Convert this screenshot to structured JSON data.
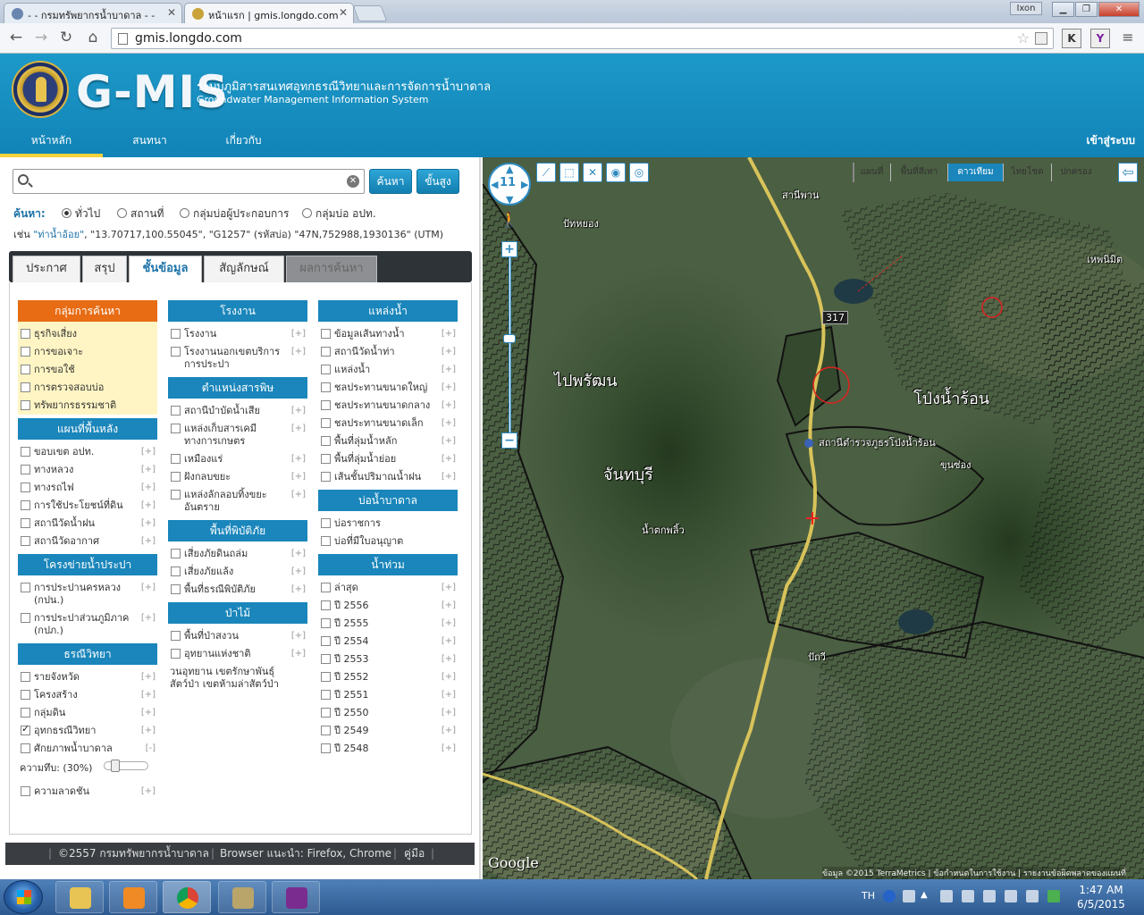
{
  "browser": {
    "tabs": [
      {
        "title": "- - กรมทรัพยากรน้ำบาดาล - -"
      },
      {
        "title": "หน้าแรก | gmis.longdo.com"
      }
    ],
    "user_badge": "Ixon",
    "address": "gmis.longdo.com",
    "toolbar_icons": [
      "K",
      "Y"
    ]
  },
  "header": {
    "brand": "G-MIS",
    "subtitle_th": "ระบบภูมิสารสนเทศอุทกธรณีวิทยาและการจัดการน้ำบาดาล",
    "subtitle_en": "Groundwater Management Information System",
    "menu": [
      {
        "label": "หน้าหลัก"
      },
      {
        "label": "สนทนา"
      },
      {
        "label": "เกี่ยวกับ"
      }
    ],
    "login": "เข้าสู่ระบบ"
  },
  "search": {
    "placeholder": "",
    "search_btn": "ค้นหา",
    "advanced_btn": "ขั้นสูง",
    "label": "ค้นหา:",
    "options": [
      {
        "label": "ทั่วไป",
        "selected": true
      },
      {
        "label": "สถานที่",
        "selected": false
      },
      {
        "label": "กลุ่มบ่อผู้ประกอบการ",
        "selected": false
      },
      {
        "label": "กลุ่มบ่อ อปท.",
        "selected": false
      }
    ],
    "example_prefix": "เช่น ",
    "example_hl": "\"ท่าน้ำอ้อย\"",
    "example_rest": ", \"13.70717,100.55045\", \"G1257\" (รหัสบ่อ) \"47N,752988,1930136\" (UTM)"
  },
  "panel_tabs": [
    {
      "label": "ประกาศ"
    },
    {
      "label": "สรุป"
    },
    {
      "label": "ชั้นข้อมูล"
    },
    {
      "label": "สัญลักษณ์"
    },
    {
      "label": "ผลการค้นหา"
    }
  ],
  "layers": {
    "col1": [
      {
        "title": "กลุ่มการค้นหา",
        "style": "orange",
        "items": [
          {
            "label": "ธุรกิจเสี่ยง"
          },
          {
            "label": "การขอเจาะ"
          },
          {
            "label": "การขอใช้"
          },
          {
            "label": "การตรวจสอบบ่อ"
          },
          {
            "label": "ทรัพยากรธรรมชาติ"
          }
        ]
      },
      {
        "title": "แผนที่พื้นหลัง",
        "items": [
          {
            "label": "ขอบเขต อปท.",
            "plus": "[+]"
          },
          {
            "label": "ทางหลวง",
            "plus": "[+]"
          },
          {
            "label": "ทางรถไฟ",
            "plus": "[+]"
          },
          {
            "label": "การใช้ประโยชน์ที่ดิน",
            "plus": "[+]"
          },
          {
            "label": "สถานีวัดน้ำฝน",
            "plus": "[+]"
          },
          {
            "label": "สถานีวัดอากาศ",
            "plus": "[+]"
          }
        ]
      },
      {
        "title": "โครงข่ายน้ำประปา",
        "items": [
          {
            "label": "การประปานครหลวง (กปน.)",
            "plus": "[+]"
          },
          {
            "label": "การประปาส่วนภูมิภาค (กปภ.)",
            "plus": "[+]"
          }
        ]
      },
      {
        "title": "ธรณีวิทยา",
        "items": [
          {
            "label": "รายจังหวัด",
            "plus": "[+]"
          },
          {
            "label": "โครงสร้าง",
            "plus": "[+]"
          },
          {
            "label": "กลุ่มดิน",
            "plus": "[+]"
          },
          {
            "label": "อุทกธรณีวิทยา",
            "plus": "[+]",
            "checked": true
          },
          {
            "label": "ศักยภาพน้ำบาดาล",
            "plus": "[-]"
          }
        ]
      },
      {
        "title": "",
        "items": [
          {
            "label": "ความลาดชัน",
            "plus": "[+]"
          }
        ]
      }
    ],
    "transparency_label": "ความทึบ: (30%)",
    "transparency_value": 30,
    "col2": [
      {
        "title": "โรงงาน",
        "items": [
          {
            "label": "โรงงาน",
            "plus": "[+]"
          },
          {
            "label": "โรงงานนอกเขตบริการการประปา",
            "plus": "[+]"
          }
        ]
      },
      {
        "title": "ตำแหน่งสารพิษ",
        "items": [
          {
            "label": "สถานีบำบัดน้ำเสีย",
            "plus": "[+]"
          },
          {
            "label": "แหล่งเก็บสารเคมีทางการเกษตร",
            "plus": "[+]"
          },
          {
            "label": "เหมืองแร่",
            "plus": "[+]"
          },
          {
            "label": "ฝังกลบขยะ",
            "plus": "[+]"
          },
          {
            "label": "แหล่งลักลอบทิ้งขยะอันตราย",
            "plus": "[+]"
          }
        ]
      },
      {
        "title": "พื้นที่พิบัติภัย",
        "items": [
          {
            "label": "เสี่ยงภัยดินถล่ม",
            "plus": "[+]"
          },
          {
            "label": "เสี่ยงภัยแล้ง",
            "plus": "[+]"
          },
          {
            "label": "พื้นที่ธรณีพิบัติภัย",
            "plus": "[+]"
          }
        ]
      },
      {
        "title": "ป่าไม้",
        "items": [
          {
            "label": "พื้นที่ป่าสงวน",
            "plus": "[+]"
          },
          {
            "label": "อุทยานแห่งชาติ",
            "plus": "[+]"
          }
        ]
      }
    ],
    "col2_note": "วนอุทยาน เขตรักษาพันธุ์สัตว์ป่า เขตห้ามล่าสัตว์ป่า",
    "col3": [
      {
        "title": "แหล่งน้ำ",
        "items": [
          {
            "label": "ข้อมูลเส้นทางน้ำ",
            "plus": "[+]"
          },
          {
            "label": "สถานีวัดน้ำท่า",
            "plus": "[+]"
          },
          {
            "label": "แหล่งน้ำ",
            "plus": "[+]"
          },
          {
            "label": "ชลประทานขนาดใหญ่",
            "plus": "[+]"
          },
          {
            "label": "ชลประทานขนาดกลาง",
            "plus": "[+]"
          },
          {
            "label": "ชลประทานขนาดเล็ก",
            "plus": "[+]"
          },
          {
            "label": "พื้นที่ลุ่มน้ำหลัก",
            "plus": "[+]"
          },
          {
            "label": "พื้นที่ลุ่มน้ำย่อย",
            "plus": "[+]"
          },
          {
            "label": "เส้นชั้นปริมาณน้ำฝน",
            "plus": "[+]"
          }
        ]
      },
      {
        "title": "บ่อน้ำบาดาล",
        "items": [
          {
            "label": "บ่อราชการ"
          },
          {
            "label": "บ่อที่มีใบอนุญาต"
          }
        ]
      },
      {
        "title": "น้ำท่วม",
        "items": [
          {
            "label": "ล่าสุด",
            "plus": "[+]"
          },
          {
            "label": "ปี 2556",
            "plus": "[+]"
          },
          {
            "label": "ปี 2555",
            "plus": "[+]"
          },
          {
            "label": "ปี 2554",
            "plus": "[+]"
          },
          {
            "label": "ปี 2553",
            "plus": "[+]"
          },
          {
            "label": "ปี 2552",
            "plus": "[+]"
          },
          {
            "label": "ปี 2551",
            "plus": "[+]"
          },
          {
            "label": "ปี 2550",
            "plus": "[+]"
          },
          {
            "label": "ปี 2549",
            "plus": "[+]"
          },
          {
            "label": "ปี 2548",
            "plus": "[+]"
          }
        ]
      }
    ]
  },
  "footer": {
    "copyright": "©2557 กรมทรัพยากรน้ำบาดาล",
    "browser": "Browser แนะนำ: Firefox, Chrome",
    "manual": "คู่มือ"
  },
  "map": {
    "zoom_level": "11",
    "layer_switch": [
      {
        "label": "แผนที่",
        "active": false
      },
      {
        "label": "พื้นที่สีเทา",
        "active": false
      },
      {
        "label": "ดาวเทียม",
        "active": true
      },
      {
        "label": "ไทยโชต",
        "active": false
      },
      {
        "label": "ปกครอง",
        "active": false
      }
    ],
    "labels": [
      {
        "text": "สานีพาน",
        "big": false
      },
      {
        "text": "317",
        "big": false
      },
      {
        "text": "ปัทหยอง",
        "big": false
      },
      {
        "text": "เหพนิมิต",
        "big": false
      },
      {
        "text": "ไปพรัฒน",
        "big": true
      },
      {
        "text": "โป่งน้ำร้อน",
        "big": true
      },
      {
        "text": "จันทบุรี",
        "big": true
      },
      {
        "text": "สถานีตำรวจภูธรโป่งน้ำร้อน",
        "big": false
      },
      {
        "text": "น้ำตกพลิ้ว",
        "big": false
      },
      {
        "text": "ขุนซ่อง",
        "big": false
      },
      {
        "text": "ปัถวี",
        "big": false
      }
    ],
    "attribution": "ข้อมูล ©2015 TerraMetrics | ข้อกำหนดในการใช้งาน | รายงานข้อผิดพลาดของแผนที่"
  },
  "taskbar": {
    "lang": "TH",
    "time": "1:47 AM",
    "date": "6/5/2015"
  }
}
